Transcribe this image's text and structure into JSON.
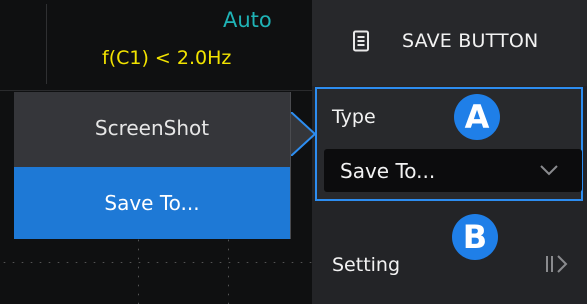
{
  "status": {
    "trigger_mode": "Auto",
    "trigger_condition": "f(C1) < 2.0Hz"
  },
  "popup_menu": {
    "items": [
      {
        "label": "ScreenShot",
        "selected": false
      },
      {
        "label": "Save To...",
        "selected": true
      }
    ]
  },
  "panel": {
    "title": "SAVE BUTTON",
    "icon": "document-icon",
    "type": {
      "label": "Type",
      "value": "Save To..."
    },
    "setting": {
      "label": "Setting",
      "icon": "submenu-arrow-icon"
    }
  },
  "callouts": {
    "a": "A",
    "b": "B"
  },
  "colors": {
    "accent": "#1e79d6",
    "trigger_mode": "#1fb3b6",
    "trigger_condition": "#f2e300"
  }
}
